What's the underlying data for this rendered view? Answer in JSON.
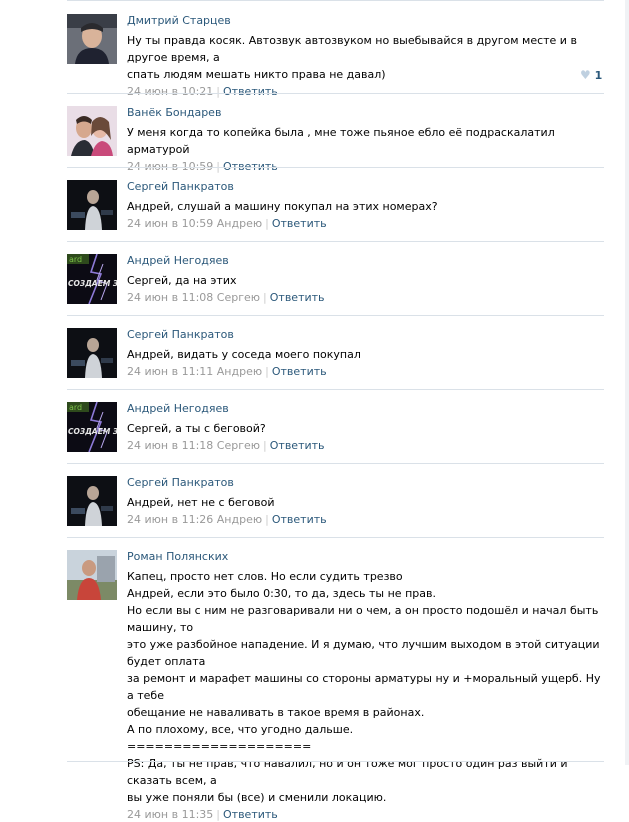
{
  "comments": [
    {
      "author": "Дмитрий Старцев",
      "text": "Ну ты правда косяк. Автозвук автозвуком но выебывайся в другом месте и в другое время, а\nспать людям мешать никто права не давал)",
      "date": "24 июн в 10:21",
      "reply_to": "",
      "reply_label": "Ответить",
      "likes": "1"
    },
    {
      "author": "Ванёк Бондарев",
      "text": "У меня когда то копейка была , мне тоже пьяное ебло её подраскалатил арматурой",
      "date": "24 июн в 10:59",
      "reply_to": "",
      "reply_label": "Ответить"
    },
    {
      "author": "Сергей Панкратов",
      "text": "Андрей, слушай а машину покупал на этих номерах?",
      "date": "24 июн в 10:59",
      "reply_to": "Андрею",
      "reply_label": "Ответить"
    },
    {
      "author": "Андрей Негодяев",
      "text": "Сергей, да на этих",
      "date": "24 июн в 11:08",
      "reply_to": "Сергею",
      "reply_label": "Ответить",
      "avatar_text": "СОЗДАЕМ ЗВУК",
      "avatar_badge": "ard"
    },
    {
      "author": "Сергей Панкратов",
      "text": "Андрей, видать у соседа моего покупал",
      "date": "24 июн в 11:11",
      "reply_to": "Андрею",
      "reply_label": "Ответить"
    },
    {
      "author": "Андрей Негодяев",
      "text": "Сергей, а ты с беговой?",
      "date": "24 июн в 11:18",
      "reply_to": "Сергею",
      "reply_label": "Ответить",
      "avatar_text": "СОЗДАЕМ ЗВУК",
      "avatar_badge": "ard"
    },
    {
      "author": "Сергей Панкратов",
      "text": "Андрей, нет не с беговой",
      "date": "24 июн в 11:26",
      "reply_to": "Андрею",
      "reply_label": "Ответить"
    },
    {
      "author": "Роман Полянских",
      "text": "Капец, просто нет слов. Но если судить трезво\nАндрей, если это было 0:30, то да, здесь ты не прав.\nНо если вы с ним не разговаривали ни о чем, а он просто подошёл и начал быть машину, то\nэто уже разбойное нападение. И я думаю, что лучшим выходом в этой ситуации будет оплата\nза ремонт и марафет машины со стороны арматуры ну и +моральный ущерб. Ну а тебе\nобещание не наваливать в такое время в районах.\nА по плохому, все, что угодно дальше.\n====================\nPS: Да, ты не прав, что навалил, но и он тоже мог просто один раз выйти и сказать всем, а\nвы уже поняли бы (все) и сменили локацию.",
      "date": "24 июн в 11:35",
      "reply_to": "",
      "reply_label": "Ответить"
    }
  ]
}
